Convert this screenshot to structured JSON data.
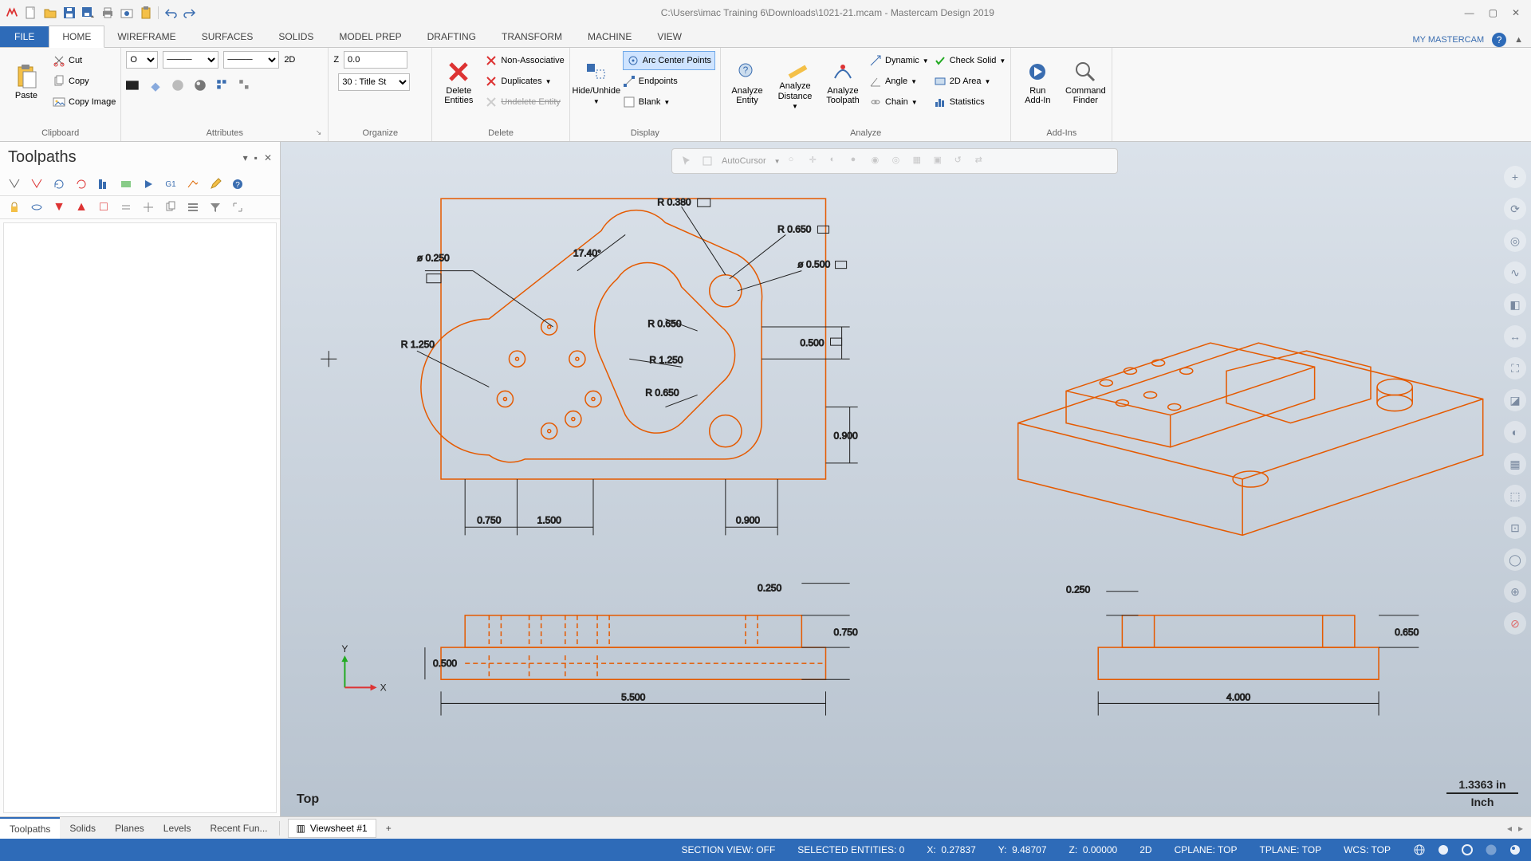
{
  "title_path": "C:\\Users\\imac Training 6\\Downloads\\1021-21.mcam - Mastercam Design 2019",
  "qat_icons": [
    "app-logo",
    "new-file",
    "open-file",
    "save",
    "save-dropdown",
    "print",
    "cut-clip",
    "paste-clip",
    "sep",
    "undo",
    "redo"
  ],
  "ribbon": {
    "file": "FILE",
    "tabs": [
      "HOME",
      "WIREFRAME",
      "SURFACES",
      "SOLIDS",
      "MODEL PREP",
      "DRAFTING",
      "TRANSFORM",
      "MACHINE",
      "VIEW"
    ],
    "active": "HOME",
    "right_link": "MY MASTERCAM"
  },
  "groups": {
    "clipboard": {
      "label": "Clipboard",
      "paste": "Paste",
      "cut": "Cut",
      "copy": "Copy",
      "copy_image": "Copy Image"
    },
    "attributes": {
      "label": "Attributes",
      "point_style": "O",
      "line_style_label": "—",
      "width_label": "—",
      "twod": "2D",
      "z_label": "Z",
      "z_value": "0.0",
      "level": "30 : Title St"
    },
    "organize": {
      "label": "Organize"
    },
    "delete": {
      "label": "Delete",
      "delete_entities": "Delete\nEntities",
      "non_assoc": "Non-Associative",
      "duplicates": "Duplicates",
      "undelete": "Undelete Entity"
    },
    "display": {
      "label": "Display",
      "hide_unhide": "Hide/Unhide",
      "arc_center": "Arc Center Points",
      "endpoints": "Endpoints",
      "blank": "Blank"
    },
    "analyze": {
      "label": "Analyze",
      "entity": "Analyze\nEntity",
      "distance": "Analyze\nDistance",
      "toolpath": "Analyze\nToolpath",
      "dynamic": "Dynamic",
      "angle": "Angle",
      "chain": "Chain",
      "check_solid": "Check Solid",
      "area2d": "2D Area",
      "statistics": "Statistics"
    },
    "addins": {
      "label": "Add-Ins",
      "run": "Run\nAdd-In",
      "finder": "Command\nFinder"
    }
  },
  "left_panel": {
    "title": "Toolpaths"
  },
  "viewport": {
    "autocursor": "AutoCursor",
    "view_label": "Top",
    "scale_value": "1.3363 in",
    "scale_unit": "Inch",
    "dims": {
      "d_phi_0250": "ø 0.250",
      "r_0380": "R 0.380",
      "ang_1740": "17.40°",
      "r_0650_a": "R 0.650",
      "phi_0500": "ø 0.500",
      "r_1250_a": "R 1.250",
      "r_0650_b": "R 0.650",
      "r_1250_b": "R 1.250",
      "r_0650_c": "R 0.650",
      "d_0500": "0.500",
      "d_0900_a": "0.900",
      "d_0750": "0.750",
      "d_1500": "1.500",
      "d_0900_b": "0.900",
      "d_0250": "0.250",
      "d_0750_b": "0.750",
      "d_0500_b": "0.500",
      "d_5500": "5.500",
      "d_0250_r": "0.250",
      "d_0650_r": "0.650",
      "d_4000": "4.000"
    },
    "axes": {
      "y": "Y",
      "x": "X"
    }
  },
  "bottom_tabs": {
    "tabs": [
      "Toolpaths",
      "Solids",
      "Planes",
      "Levels",
      "Recent Fun..."
    ],
    "active": "Toolpaths",
    "viewsheet": "Viewsheet #1"
  },
  "status": {
    "section_view": "SECTION VIEW: OFF",
    "selected": "SELECTED ENTITIES: 0",
    "x_label": "X:",
    "x_val": "0.27837",
    "y_label": "Y:",
    "y_val": "9.48707",
    "z_label": "Z:",
    "z_val": "0.00000",
    "mode": "2D",
    "cplane": "CPLANE: TOP",
    "tplane": "TPLANE: TOP",
    "wcs": "WCS: TOP"
  }
}
